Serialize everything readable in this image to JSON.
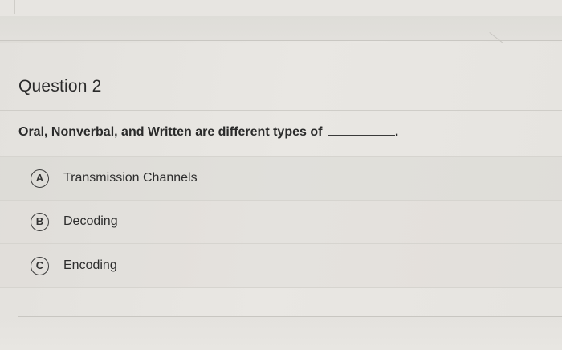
{
  "question": {
    "title": "Question 2",
    "prompt": "Oral, Nonverbal, and Written are different types of",
    "prompt_end": "."
  },
  "options": [
    {
      "letter": "A",
      "label": "Transmission Channels"
    },
    {
      "letter": "B",
      "label": "Decoding"
    },
    {
      "letter": "C",
      "label": "Encoding"
    }
  ]
}
